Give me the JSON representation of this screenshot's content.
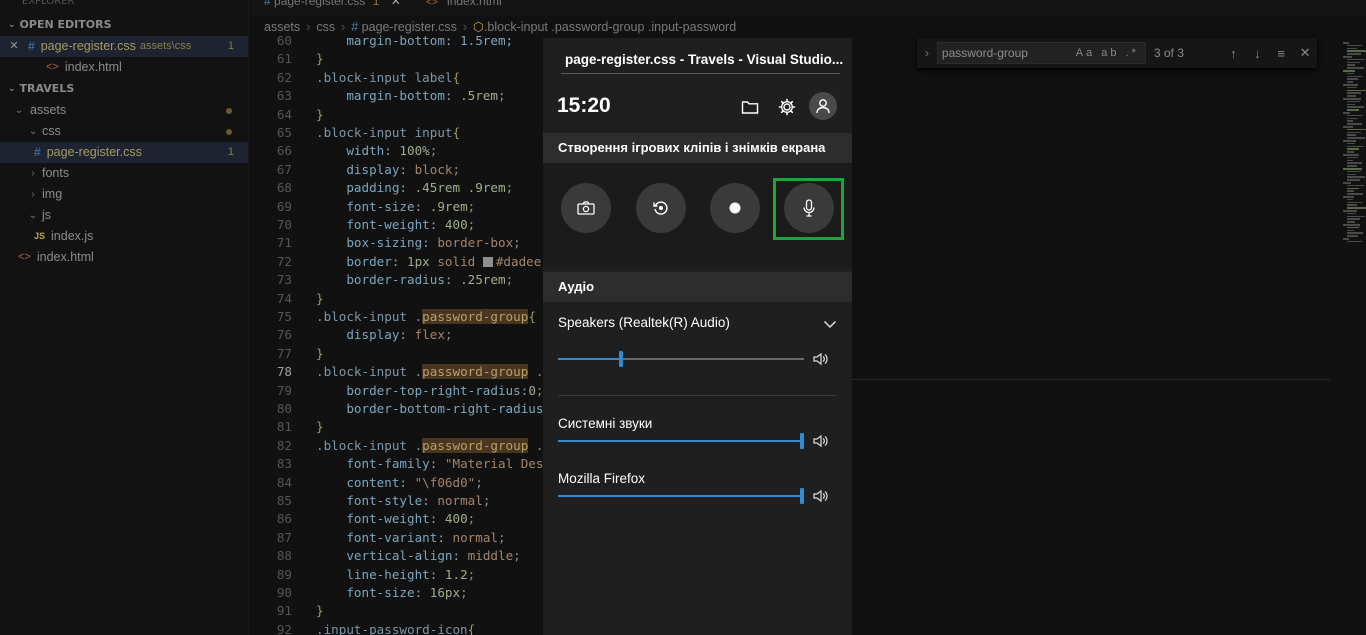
{
  "explorer": {
    "header_cut": "EXPLORER",
    "open_editors_label": "OPEN EDITORS",
    "open_editors": [
      {
        "close": "✕",
        "icon": "#",
        "name": "page-register.css",
        "desc": "assets\\css",
        "badge": "1"
      },
      {
        "icon": "<>",
        "name": "index.html"
      }
    ],
    "project_label": "TRAVELS",
    "tree": [
      {
        "name": "assets",
        "level": 1,
        "type": "folder"
      },
      {
        "name": "css",
        "level": 2,
        "type": "folder"
      },
      {
        "name": "page-register.css",
        "level": 3,
        "type": "css",
        "badge": "1"
      },
      {
        "name": "fonts",
        "level": 2,
        "type": "folder-closed"
      },
      {
        "name": "img",
        "level": 2,
        "type": "folder-closed"
      },
      {
        "name": "js",
        "level": 2,
        "type": "folder"
      },
      {
        "name": "index.js",
        "level": 3,
        "type": "js"
      },
      {
        "name": "index.html",
        "level": 1,
        "type": "html"
      }
    ]
  },
  "tabs": [
    {
      "name": "page-register.css",
      "suffix": "1"
    },
    {
      "name": "index.html"
    }
  ],
  "breadcrumb": {
    "parts": [
      "assets",
      "css",
      "page-register.css",
      ".block-input .password-group .input-password"
    ]
  },
  "find": {
    "value": "password-group",
    "options": "Aa ab .*",
    "count": "3 of 3"
  },
  "code": [
    {
      "n": "60",
      "segs": [
        [
          "p",
          "    margin-bottom: 1.5rem;"
        ]
      ]
    },
    {
      "n": "61",
      "segs": [
        [
          "b",
          "}"
        ]
      ]
    },
    {
      "n": "62",
      "segs": [
        [
          "s",
          ".block-input label"
        ],
        [
          "b",
          "{"
        ]
      ]
    },
    {
      "n": "63",
      "segs": [
        [
          "p",
          "    margin-bottom: "
        ],
        [
          "n",
          ".5rem"
        ],
        [
          "t",
          ";"
        ]
      ]
    },
    {
      "n": "64",
      "segs": [
        [
          "b",
          "}"
        ]
      ]
    },
    {
      "n": "65",
      "segs": [
        [
          "s",
          ".block-input input"
        ],
        [
          "b",
          "{"
        ]
      ]
    },
    {
      "n": "66",
      "segs": [
        [
          "p",
          "    width: "
        ],
        [
          "n",
          "100%"
        ],
        [
          "t",
          ";"
        ]
      ]
    },
    {
      "n": "67",
      "segs": [
        [
          "p",
          "    display: "
        ],
        [
          "k",
          "block"
        ],
        [
          "t",
          ";"
        ]
      ]
    },
    {
      "n": "68",
      "segs": [
        [
          "p",
          "    padding: "
        ],
        [
          "n",
          ".45rem .9rem"
        ],
        [
          "t",
          ";"
        ]
      ]
    },
    {
      "n": "69",
      "segs": [
        [
          "p",
          "    font-size: "
        ],
        [
          "n",
          ".9rem"
        ],
        [
          "t",
          ";"
        ]
      ]
    },
    {
      "n": "70",
      "segs": [
        [
          "p",
          "    font-weight: "
        ],
        [
          "n",
          "400"
        ],
        [
          "t",
          ";"
        ]
      ]
    },
    {
      "n": "71",
      "segs": [
        [
          "p",
          "    box-sizing: "
        ],
        [
          "k",
          "border-box"
        ],
        [
          "t",
          ";"
        ]
      ]
    },
    {
      "n": "72",
      "segs": [
        [
          "p",
          "    border: "
        ],
        [
          "n",
          "1px "
        ],
        [
          "k",
          "solid "
        ],
        [
          "w",
          ""
        ],
        [
          "k",
          "#dadee"
        ]
      ]
    },
    {
      "n": "73",
      "segs": [
        [
          "p",
          "    border-radius: "
        ],
        [
          "n",
          ".25rem"
        ],
        [
          "t",
          ";"
        ]
      ]
    },
    {
      "n": "74",
      "segs": [
        [
          "b",
          "}"
        ]
      ]
    },
    {
      "n": "75",
      "segs": [
        [
          "s",
          ".block-input ."
        ],
        [
          "h",
          "password-group"
        ],
        [
          "b",
          "{"
        ]
      ]
    },
    {
      "n": "76",
      "segs": [
        [
          "p",
          "    display: "
        ],
        [
          "k",
          "flex"
        ],
        [
          "t",
          ";"
        ]
      ]
    },
    {
      "n": "77",
      "segs": [
        [
          "b",
          "}"
        ]
      ]
    },
    {
      "n": "78",
      "segs": [
        [
          "s",
          ".block-input ."
        ],
        [
          "h",
          "password-group"
        ],
        [
          "s",
          " ."
        ]
      ]
    },
    {
      "n": "79",
      "segs": [
        [
          "p",
          "    border-top-right-radius:"
        ],
        [
          "n",
          "0"
        ],
        [
          "t",
          ";"
        ]
      ]
    },
    {
      "n": "80",
      "segs": [
        [
          "p",
          "    border-bottom-right-radius"
        ]
      ]
    },
    {
      "n": "81",
      "segs": [
        [
          "b",
          "}"
        ]
      ]
    },
    {
      "n": "82",
      "segs": [
        [
          "s",
          ".block-input ."
        ],
        [
          "h",
          "password-group"
        ],
        [
          "s",
          " ."
        ]
      ]
    },
    {
      "n": "83",
      "segs": [
        [
          "p",
          "    font-family: "
        ],
        [
          "r",
          "\"Material Des"
        ]
      ]
    },
    {
      "n": "84",
      "segs": [
        [
          "p",
          "    content: "
        ],
        [
          "r",
          "\"\\f06d0\""
        ],
        [
          "t",
          ";"
        ]
      ]
    },
    {
      "n": "85",
      "segs": [
        [
          "p",
          "    font-style: "
        ],
        [
          "k",
          "normal"
        ],
        [
          "t",
          ";"
        ]
      ]
    },
    {
      "n": "86",
      "segs": [
        [
          "p",
          "    font-weight: "
        ],
        [
          "n",
          "400"
        ],
        [
          "t",
          ";"
        ]
      ]
    },
    {
      "n": "87",
      "segs": [
        [
          "p",
          "    font-variant: "
        ],
        [
          "k",
          "normal"
        ],
        [
          "t",
          ";"
        ]
      ]
    },
    {
      "n": "88",
      "segs": [
        [
          "p",
          "    vertical-align: "
        ],
        [
          "k",
          "middle"
        ],
        [
          "t",
          ";"
        ]
      ]
    },
    {
      "n": "89",
      "segs": [
        [
          "p",
          "    line-height: "
        ],
        [
          "n",
          "1.2"
        ],
        [
          "t",
          ";"
        ]
      ]
    },
    {
      "n": "90",
      "segs": [
        [
          "p",
          "    font-size: "
        ],
        [
          "n",
          "16px"
        ],
        [
          "t",
          ";"
        ]
      ]
    },
    {
      "n": "91",
      "segs": [
        [
          "b",
          "}"
        ]
      ]
    },
    {
      "n": "92",
      "segs": [
        [
          "s",
          ".input-password-icon"
        ],
        [
          "b",
          "{"
        ]
      ]
    }
  ],
  "current_line": "78",
  "gamebar": {
    "title": "page-register.css - Travels - Visual Studio...",
    "time": "15:20",
    "capture_section": "Створення ігрових кліпів і знімків екрана",
    "audio_section": "Аудіо",
    "device": "Speakers (Realtek(R) Audio)",
    "master_volume": 0.25,
    "apps": [
      {
        "name": "Системні звуки",
        "volume": 1.0
      },
      {
        "name": "Mozilla Firefox",
        "volume": 1.0
      }
    ],
    "accent_color": "#2f8bd6",
    "focus_color": "#1fa33a",
    "capture_buttons": [
      "camera-icon",
      "replay-icon",
      "record-icon",
      "microphone-icon"
    ]
  }
}
